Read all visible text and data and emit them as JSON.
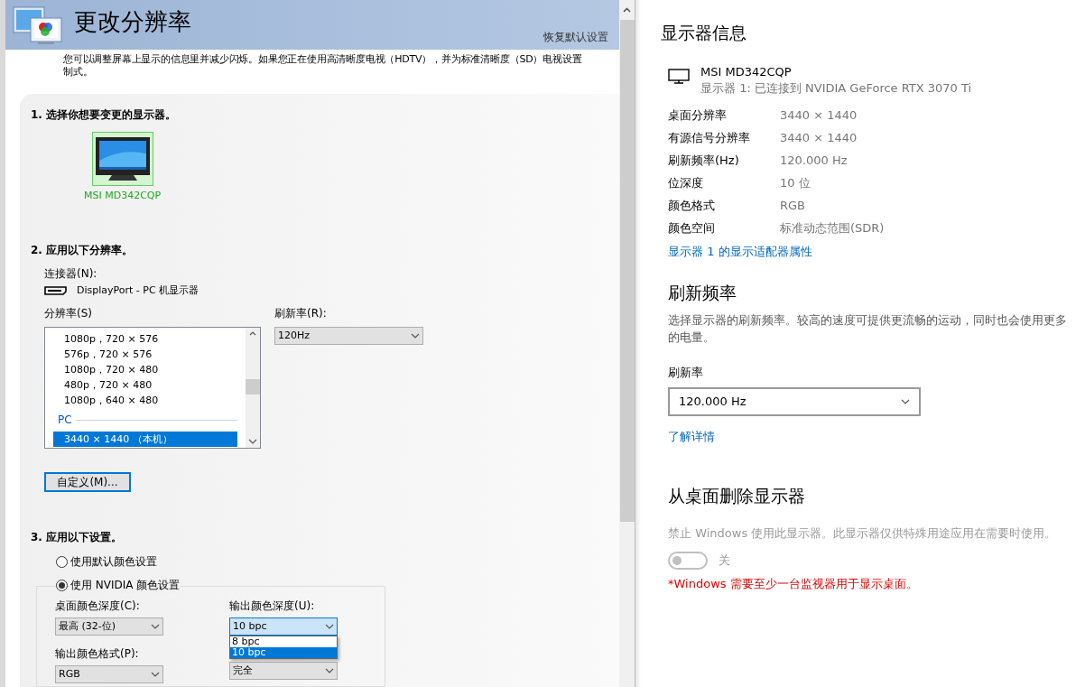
{
  "nvidia_panel": {
    "title": "更改分辨率",
    "restore_link": "恢复默认设置",
    "description": [
      "您可以调整屏幕上显示的信息里并减少闪烁。如果您正在使用高清晰度电视（HDTV），并为标准清晰度（SD）电视设置",
      "制式。"
    ],
    "step1": {
      "heading": "1. 选择你想要变更的显示器。",
      "displays": [
        {
          "label": "MSI MD342CQP",
          "selected": true
        }
      ]
    },
    "step2": {
      "heading": "2. 应用以下分辨率。",
      "connector_label": "连接器(N):",
      "connector": "DisplayPort - PC 机显示器",
      "resolution_label": "分辨率(S)",
      "resolutions": [
        {
          "kind": "item",
          "label": "1080p，720 × 576",
          "selected": false
        },
        {
          "kind": "item",
          "label": "576p，720 × 576",
          "selected": false
        },
        {
          "kind": "item",
          "label": "1080p，720 × 480",
          "selected": false
        },
        {
          "kind": "item",
          "label": "480p，720 × 480",
          "selected": false
        },
        {
          "kind": "item",
          "label": "1080p，640 × 480",
          "selected": false
        },
        {
          "kind": "group",
          "label": "PC"
        },
        {
          "kind": "item",
          "label": "3440 × 1440 （本机）",
          "selected": true
        }
      ],
      "refresh_label": "刷新率(R):",
      "refresh_value": "120Hz",
      "custom_button": "自定义(M)..."
    },
    "step3": {
      "heading": "3. 应用以下设置。",
      "color_options": [
        {
          "label": "使用默认颜色设置",
          "selected": false
        },
        {
          "label": "使用 NVIDIA 颜色设置",
          "selected": true
        }
      ],
      "fields": [
        {
          "label": "桌面颜色深度(C):",
          "value": "最高 (32-位)",
          "expanded": false
        },
        {
          "label": "输出颜色深度(U):",
          "value": "10 bpc",
          "expanded": true,
          "options": [
            {
              "label": "8 bpc",
              "selected": false
            },
            {
              "label": "10 bpc",
              "selected": true
            }
          ]
        },
        {
          "label": "输出颜色格式(P):",
          "value": "RGB",
          "expanded": false
        },
        {
          "value": "完全",
          "expanded": false
        }
      ]
    }
  },
  "display_info": {
    "title": "显示器信息",
    "monitor_name": "MSI MD342CQP",
    "monitor_subtitle": "显示器 1: 已连接到 NVIDIA GeForce RTX 3070 Ti",
    "properties": [
      {
        "label": "桌面分辨率",
        "value": "3440 × 1440"
      },
      {
        "label": "有源信号分辨率",
        "value": "3440 × 1440"
      },
      {
        "label": "刷新频率(Hz)",
        "value": "120.000 Hz"
      },
      {
        "label": "位深度",
        "value": "10 位"
      },
      {
        "label": "颜色格式",
        "value": "RGB"
      },
      {
        "label": "颜色空间",
        "value": "标准动态范围(SDR)"
      }
    ],
    "adapter_link": "显示器 1 的显示适配器属性"
  },
  "refresh_rate": {
    "title": "刷新频率",
    "description": "选择显示器的刷新频率。较高的速度可提供更流畅的运动，同时也会使用更多的电量。",
    "select_label": "刷新率",
    "value": "120.000 Hz",
    "learn_more": "了解详情"
  },
  "remove_display": {
    "title": "从桌面删除显示器",
    "description": "禁止 Windows 使用此显示器。此显示器仅供特殊用途应用在需要时使用。",
    "toggle": {
      "on": false,
      "label": "关"
    },
    "warning": "*Windows 需要至少一台监视器用于显示桌面。"
  }
}
